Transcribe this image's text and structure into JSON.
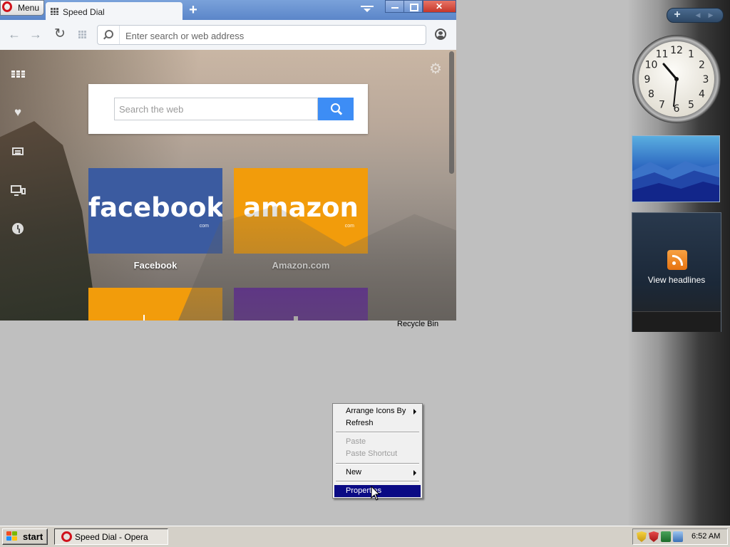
{
  "browser": {
    "menu_label": "Menu",
    "tab_title": "Speed Dial",
    "address_placeholder": "Enter search or web address"
  },
  "speed_dial": {
    "search_placeholder": "Search the web",
    "tiles": [
      {
        "logo": "facebook",
        "domain_mark": "com",
        "label": "Facebook",
        "color": "#3b5ba0"
      },
      {
        "logo": "amazon",
        "domain_mark": "com",
        "label": "Amazon.com",
        "color": "#f29c0b"
      }
    ],
    "more_tiles_colors": [
      "#f29c0b",
      "#5c17a6"
    ]
  },
  "desktop": {
    "recycle_bin_label": "Recycle Bin"
  },
  "gadgets": {
    "feeds_label": "View headlines",
    "clock_face_numbers": [
      "12",
      "1",
      "2",
      "3",
      "4",
      "5",
      "6",
      "7",
      "8",
      "9",
      "10",
      "11"
    ]
  },
  "context_menu": {
    "items": [
      {
        "label": "Arrange Icons By",
        "submenu": true,
        "enabled": true
      },
      {
        "label": "Refresh",
        "submenu": false,
        "enabled": true
      },
      {
        "label": "Paste",
        "submenu": false,
        "enabled": false
      },
      {
        "label": "Paste Shortcut",
        "submenu": false,
        "enabled": false
      },
      {
        "label": "New",
        "submenu": true,
        "enabled": true
      },
      {
        "label": "Properties",
        "submenu": false,
        "enabled": true,
        "highlighted": true
      }
    ]
  },
  "taskbar": {
    "start_label": "start",
    "task_label": "Speed Dial - Opera",
    "time": "6:52 AM"
  },
  "colors": {
    "desktop_bg": "#bfbfbf",
    "highlight": "#0a0a84",
    "search_button": "#3d8df5"
  }
}
